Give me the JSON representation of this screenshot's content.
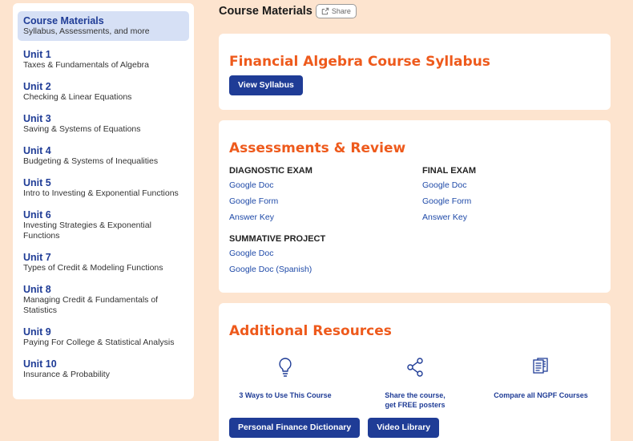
{
  "sidebar": {
    "items": [
      {
        "title": "Course Materials",
        "sub": "Syllabus, Assessments, and more"
      },
      {
        "title": "Unit 1",
        "sub": "Taxes & Fundamentals of Algebra"
      },
      {
        "title": "Unit 2",
        "sub": "Checking & Linear Equations"
      },
      {
        "title": "Unit 3",
        "sub": "Saving & Systems of Equations"
      },
      {
        "title": "Unit 4",
        "sub": "Budgeting & Systems of Inequalities"
      },
      {
        "title": "Unit 5",
        "sub": "Intro to Investing & Exponential Functions"
      },
      {
        "title": "Unit 6",
        "sub": "Investing Strategies & Exponential Functions"
      },
      {
        "title": "Unit 7",
        "sub": "Types of Credit & Modeling Functions"
      },
      {
        "title": "Unit 8",
        "sub": "Managing Credit & Fundamentals of Statistics"
      },
      {
        "title": "Unit 9",
        "sub": "Paying For College & Statistical Analysis"
      },
      {
        "title": "Unit 10",
        "sub": "Insurance & Probability"
      }
    ]
  },
  "header": {
    "title": "Course Materials",
    "share_label": "Share"
  },
  "syllabus": {
    "title": "Financial Algebra Course Syllabus",
    "button": "View Syllabus"
  },
  "assessments": {
    "title": "Assessments & Review",
    "diagnostic": {
      "heading": "DIAGNOSTIC EXAM",
      "links": [
        "Google Doc",
        "Google Form",
        "Answer Key"
      ]
    },
    "final": {
      "heading": "FINAL EXAM",
      "links": [
        "Google Doc",
        "Google Form",
        "Answer Key"
      ]
    },
    "summative": {
      "heading": "SUMMATIVE PROJECT",
      "links": [
        "Google Doc",
        "Google Doc (Spanish)"
      ]
    }
  },
  "resources": {
    "title": "Additional Resources",
    "items": [
      {
        "icon": "lightbulb-icon",
        "label": "3 Ways to Use This Course"
      },
      {
        "icon": "share-icon",
        "label_line1": "Share the course,",
        "label_line2": "get FREE posters"
      },
      {
        "icon": "documents-icon",
        "label": "Compare all NGPF Courses"
      }
    ],
    "buttons": [
      "Personal Finance Dictionary",
      "Video Library"
    ]
  },
  "colors": {
    "accent": "#ee5a1c",
    "brand": "#1f3c96",
    "background": "#fde4cf"
  }
}
